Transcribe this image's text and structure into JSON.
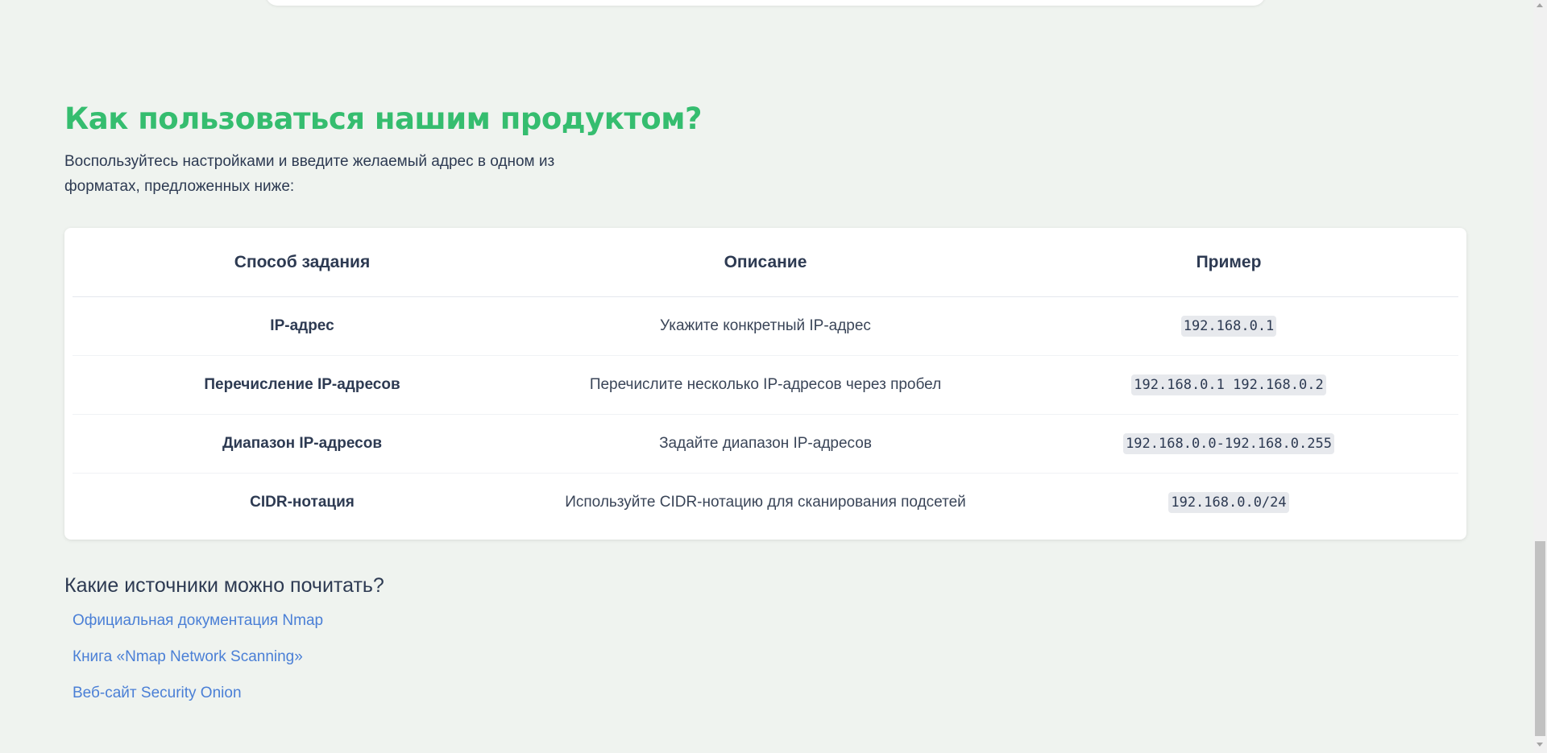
{
  "howto": {
    "title": "Как пользоваться нашим продуктом?",
    "intro": "Воспользуйтесь настройками и введите желаемый адрес в одном из форматах, предложенных ниже:"
  },
  "table": {
    "headers": [
      "Способ задания",
      "Описание",
      "Пример"
    ],
    "rows": [
      {
        "method": "IP-адрес",
        "description": "Укажите конкретный IP-адрес",
        "example": "192.168.0.1"
      },
      {
        "method": "Перечисление IP-адресов",
        "description": "Перечислите несколько IP-адресов через пробел",
        "example": "192.168.0.1 192.168.0.2"
      },
      {
        "method": "Диапазон IP-адресов",
        "description": "Задайте диапазон IP-адресов",
        "example": "192.168.0.0-192.168.0.255"
      },
      {
        "method": "CIDR-нотация",
        "description": "Используйте CIDR-нотацию для сканирования подсетей",
        "example": "192.168.0.0/24"
      }
    ]
  },
  "sources": {
    "title": "Какие источники можно почитать?",
    "links": [
      {
        "label": "Официальная документация Nmap"
      },
      {
        "label": "Книга «Nmap Network Scanning»"
      },
      {
        "label": "Веб-сайт Security Onion"
      }
    ]
  },
  "colors": {
    "accent_green": "#35bd6f",
    "link_blue": "#4a7fd6",
    "background": "#eff3ef"
  }
}
